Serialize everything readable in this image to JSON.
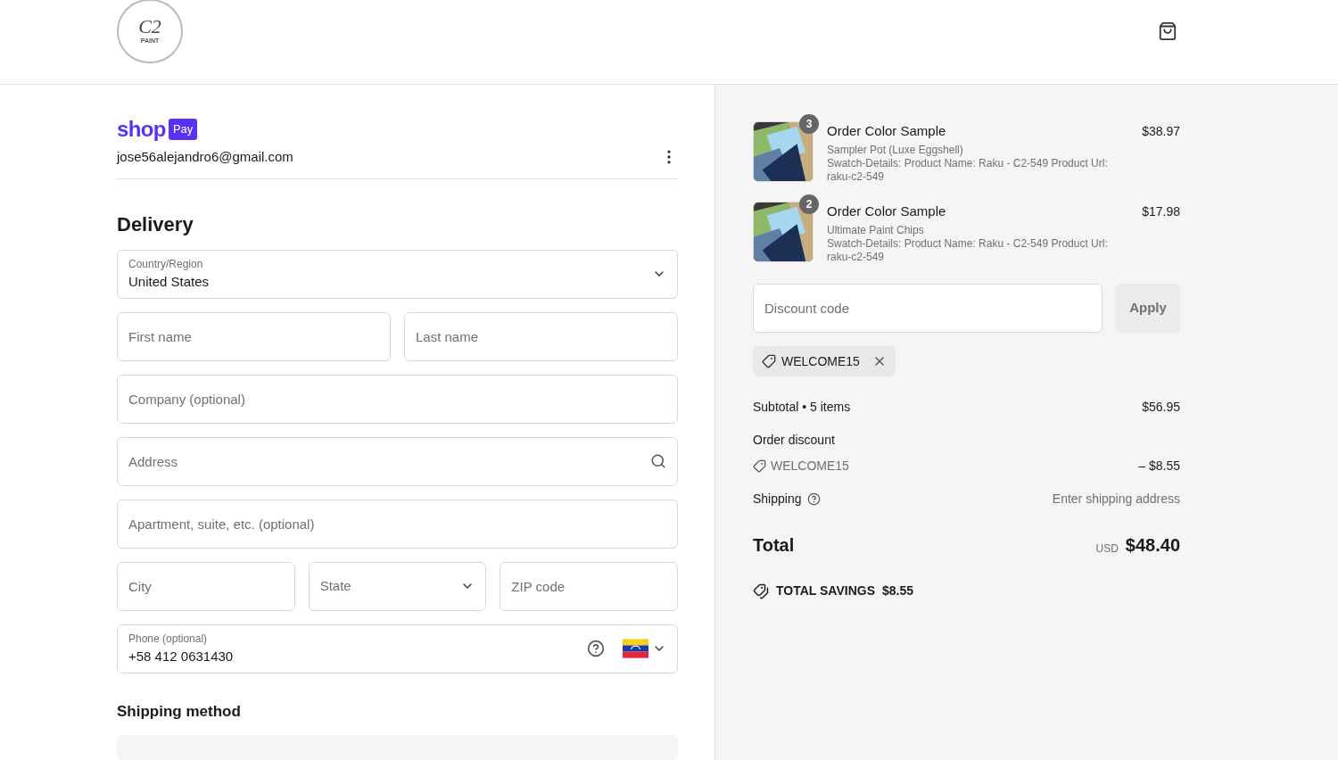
{
  "header": {
    "logo": {
      "monogram": "C2",
      "word": "PAINT"
    }
  },
  "account": {
    "brand": "shop",
    "badge": "Pay",
    "email": "jose56alejandro6@gmail.com"
  },
  "delivery": {
    "title": "Delivery",
    "country": {
      "label": "Country/Region",
      "value": "United States"
    },
    "rows": [
      [
        {
          "kind": "text",
          "placeholder": "First name"
        },
        {
          "kind": "text",
          "placeholder": "Last name"
        }
      ],
      [
        {
          "kind": "text",
          "placeholder": "Company (optional)"
        }
      ],
      [
        {
          "kind": "search",
          "placeholder": "Address"
        }
      ],
      [
        {
          "kind": "text",
          "placeholder": "Apartment, suite, etc. (optional)"
        }
      ],
      [
        {
          "kind": "text",
          "placeholder": "City"
        },
        {
          "kind": "select",
          "placeholder": "State"
        },
        {
          "kind": "text",
          "placeholder": "ZIP code"
        }
      ]
    ],
    "phone": {
      "label": "Phone (optional)",
      "value": "+58 412 0631430"
    }
  },
  "shipping_method": {
    "title": "Shipping method"
  },
  "summary": {
    "items": [
      {
        "quantity": "3",
        "name": "Order Color Sample",
        "variant": "Sampler Pot (Luxe Eggshell)",
        "details": "Swatch-Details: Product Name: Raku - C2-549 Product Url: raku-c2-549",
        "price": "$38.97"
      },
      {
        "quantity": "2",
        "name": "Order Color Sample",
        "variant": "Ultimate Paint Chips",
        "details": "Swatch-Details: Product Name: Raku - C2-549 Product Url: raku-c2-549",
        "price": "$17.98"
      }
    ],
    "discount": {
      "placeholder": "Discount code",
      "button": "Apply",
      "applied": "WELCOME15"
    },
    "subtotal": {
      "label": "Subtotal • 5 items",
      "value": "$56.95"
    },
    "order_discount": {
      "label": "Order discount",
      "code": "WELCOME15",
      "value": "– $8.55"
    },
    "shipping": {
      "label": "Shipping",
      "value": "Enter shipping address"
    },
    "total": {
      "label": "Total",
      "currency": "USD",
      "value": "$48.40"
    },
    "savings": {
      "label": "TOTAL SAVINGS",
      "value": "$8.55"
    }
  }
}
